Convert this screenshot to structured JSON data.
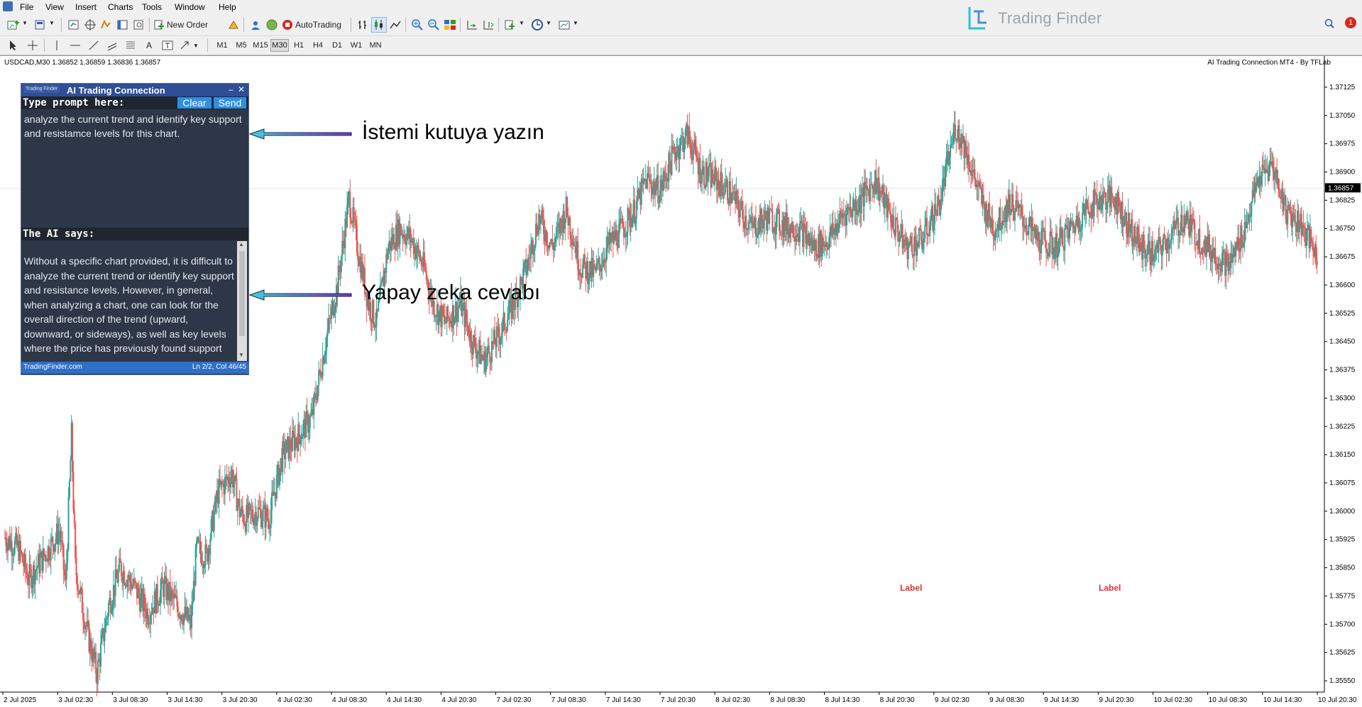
{
  "menubar": {
    "items": [
      "File",
      "View",
      "Insert",
      "Charts",
      "Tools",
      "Window",
      "Help"
    ]
  },
  "toolbar": {
    "new_order_label": "New Order",
    "autotrading_label": "AutoTrading",
    "timeframes": [
      "M1",
      "M5",
      "M15",
      "M30",
      "H1",
      "H4",
      "D1",
      "W1",
      "MN"
    ],
    "active_timeframe": "M30"
  },
  "brand": {
    "name": "Trading Finder",
    "notification_count": "1"
  },
  "chart": {
    "symbol_info": "USDCAD,M30  1.36852 1.36859 1.36836 1.36857",
    "ea_label": "AI Trading Connection MT4 - By TFLab",
    "current_price": "1.36857",
    "labels": [
      "Label",
      "Label"
    ],
    "colors": {
      "bull": "#26a69a",
      "bear": "#ef5350",
      "label": "#e03030"
    }
  },
  "chart_data": {
    "type": "candlestick",
    "y_ticks": [
      "1.37125",
      "1.37050",
      "1.36975",
      "1.36900",
      "1.36825",
      "1.36750",
      "1.36675",
      "1.36600",
      "1.36525",
      "1.36450",
      "1.36375",
      "1.36300",
      "1.36225",
      "1.36150",
      "1.36075",
      "1.36000",
      "1.35925",
      "1.35850",
      "1.35775",
      "1.35700",
      "1.35625",
      "1.35550"
    ],
    "x_ticks": [
      "2 Jul 2025",
      "3 Jul 02:30",
      "3 Jul 08:30",
      "3 Jul 14:30",
      "3 Jul 20:30",
      "4 Jul 02:30",
      "4 Jul 08:30",
      "4 Jul 14:30",
      "4 Jul 20:30",
      "7 Jul 02:30",
      "7 Jul 08:30",
      "7 Jul 14:30",
      "7 Jul 20:30",
      "8 Jul 02:30",
      "8 Jul 08:30",
      "8 Jul 14:30",
      "8 Jul 20:30",
      "9 Jul 02:30",
      "9 Jul 08:30",
      "9 Jul 14:30",
      "9 Jul 20:30",
      "10 Jul 02:30",
      "10 Jul 08:30",
      "10 Jul 14:30",
      "10 Jul 20:30"
    ],
    "ylim": [
      1.3552,
      1.3717
    ],
    "close_path": [
      [
        0,
        1.3593
      ],
      [
        14,
        1.359
      ],
      [
        24,
        1.3582
      ],
      [
        40,
        1.3588
      ],
      [
        56,
        1.3595
      ],
      [
        62,
        1.358
      ],
      [
        68,
        1.362
      ],
      [
        72,
        1.3585
      ],
      [
        84,
        1.3568
      ],
      [
        94,
        1.3557
      ],
      [
        106,
        1.3575
      ],
      [
        118,
        1.3585
      ],
      [
        132,
        1.358
      ],
      [
        146,
        1.3573
      ],
      [
        162,
        1.358
      ],
      [
        176,
        1.3575
      ],
      [
        190,
        1.357
      ],
      [
        196,
        1.359
      ],
      [
        206,
        1.3588
      ],
      [
        218,
        1.3605
      ],
      [
        232,
        1.361
      ],
      [
        240,
        1.36
      ],
      [
        246,
        1.3598
      ],
      [
        258,
        1.36
      ],
      [
        270,
        1.3598
      ],
      [
        284,
        1.3615
      ],
      [
        300,
        1.362
      ],
      [
        314,
        1.3625
      ],
      [
        328,
        1.3645
      ],
      [
        340,
        1.366
      ],
      [
        352,
        1.3683
      ],
      [
        362,
        1.3668
      ],
      [
        372,
        1.3655
      ],
      [
        380,
        1.365
      ],
      [
        392,
        1.367
      ],
      [
        404,
        1.3675
      ],
      [
        416,
        1.3672
      ],
      [
        428,
        1.3665
      ],
      [
        438,
        1.3655
      ],
      [
        450,
        1.365
      ],
      [
        466,
        1.3655
      ],
      [
        478,
        1.3645
      ],
      [
        490,
        1.364
      ],
      [
        506,
        1.3647
      ],
      [
        520,
        1.3655
      ],
      [
        534,
        1.3665
      ],
      [
        546,
        1.3678
      ],
      [
        560,
        1.367
      ],
      [
        574,
        1.368
      ],
      [
        582,
        1.3672
      ],
      [
        588,
        1.3665
      ],
      [
        604,
        1.3663
      ],
      [
        616,
        1.367
      ],
      [
        632,
        1.3675
      ],
      [
        644,
        1.368
      ],
      [
        656,
        1.3688
      ],
      [
        670,
        1.3685
      ],
      [
        684,
        1.3695
      ],
      [
        698,
        1.37
      ],
      [
        712,
        1.369
      ],
      [
        726,
        1.3688
      ],
      [
        740,
        1.3685
      ],
      [
        752,
        1.368
      ],
      [
        764,
        1.3675
      ],
      [
        780,
        1.3678
      ],
      [
        796,
        1.3676
      ],
      [
        812,
        1.3675
      ],
      [
        828,
        1.367
      ],
      [
        842,
        1.3672
      ],
      [
        858,
        1.3679
      ],
      [
        874,
        1.3682
      ],
      [
        890,
        1.3688
      ],
      [
        906,
        1.3678
      ],
      [
        922,
        1.367
      ],
      [
        938,
        1.3672
      ],
      [
        956,
        1.3682
      ],
      [
        972,
        1.3702
      ],
      [
        980,
        1.3698
      ],
      [
        992,
        1.3688
      ],
      [
        1002,
        1.368
      ],
      [
        1012,
        1.3675
      ],
      [
        1028,
        1.3682
      ],
      [
        1040,
        1.3678
      ],
      [
        1056,
        1.3672
      ],
      [
        1074,
        1.367
      ],
      [
        1090,
        1.3675
      ],
      [
        1106,
        1.368
      ],
      [
        1120,
        1.3683
      ],
      [
        1136,
        1.3683
      ],
      [
        1148,
        1.3676
      ],
      [
        1162,
        1.367
      ],
      [
        1176,
        1.3668
      ],
      [
        1190,
        1.3672
      ],
      [
        1206,
        1.3678
      ],
      [
        1222,
        1.3672
      ],
      [
        1238,
        1.3668
      ],
      [
        1252,
        1.3665
      ],
      [
        1268,
        1.3675
      ],
      [
        1282,
        1.3688
      ],
      [
        1296,
        1.3692
      ],
      [
        1310,
        1.368
      ],
      [
        1326,
        1.3676
      ],
      [
        1342,
        1.3668
      ]
    ],
    "annotations": [
      {
        "text": "İstemi kutuya yazın"
      },
      {
        "text": "Yapay zeka cevabı"
      }
    ]
  },
  "ai_panel": {
    "logo_text": "Trading Finder",
    "title": "AI Trading Connection",
    "minimize_glyph": "–",
    "close_glyph": "✕",
    "prompt_label": "Type prompt here:",
    "clear_label": "Clear",
    "send_label": "Send",
    "prompt_text": "analyze the current trend and identify key support and resistamce levels for this chart.",
    "response_label": "The AI says:",
    "response_text": "Without a specific chart provided, it is difficult to analyze the current trend or identify key support and resistance levels. However, in general, when analyzing a chart, one can look for the overall direction of the trend (upward, downward, or sideways), as well as key levels where the price has previously found support",
    "status_left": "TradingFinder.com",
    "status_right": "Ln 2/2, Col 46/45",
    "scroll_up_glyph": "▲",
    "scroll_down_glyph": "▼"
  }
}
